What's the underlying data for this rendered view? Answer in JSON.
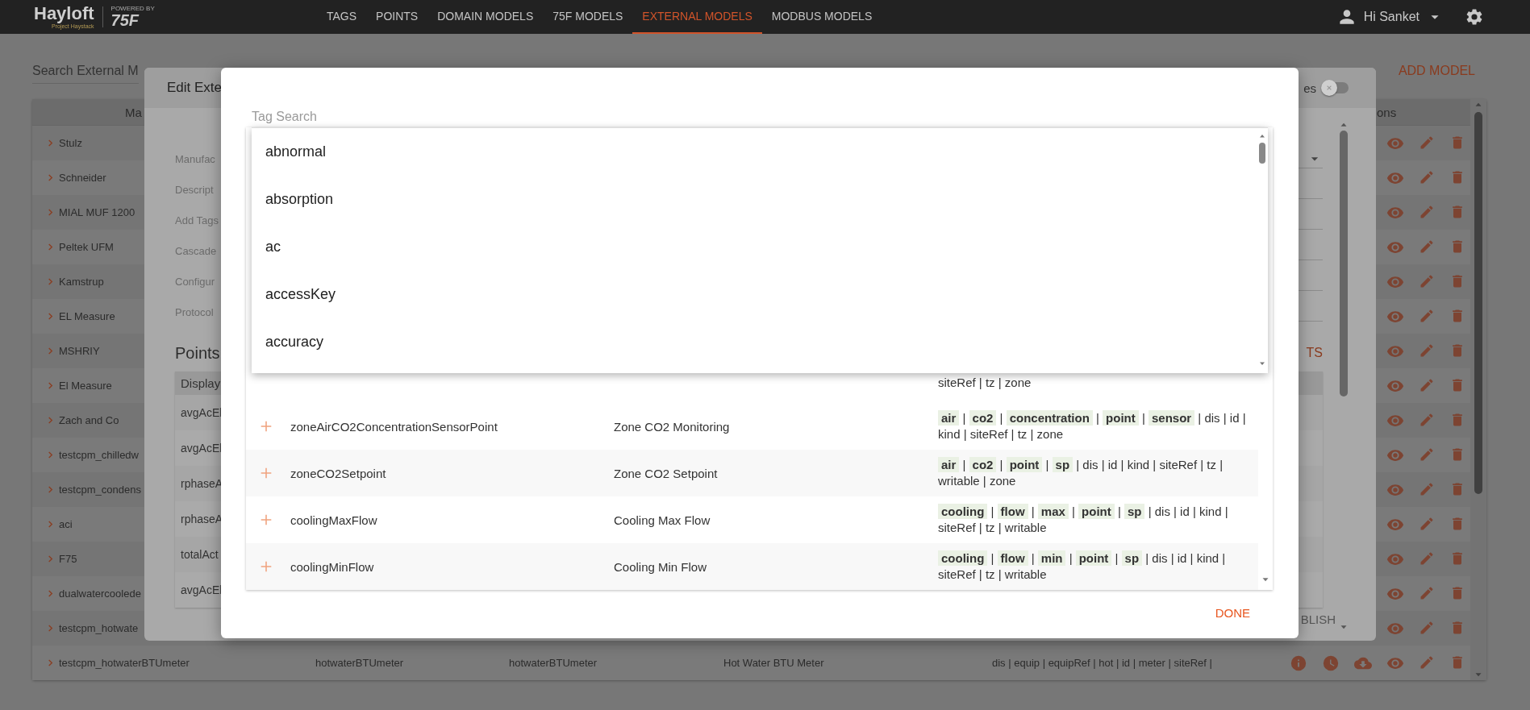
{
  "nav": {
    "logo": "Hayloft",
    "logo_subtitle": "Project Haystack",
    "powered_by": "POWERED BY",
    "brand": "75F",
    "items": [
      {
        "label": "TAGS",
        "selected": false
      },
      {
        "label": "POINTS",
        "selected": false
      },
      {
        "label": "DOMAIN MODELS",
        "selected": false
      },
      {
        "label": "75F MODELS",
        "selected": false
      },
      {
        "label": "EXTERNAL MODELS",
        "selected": true
      },
      {
        "label": "MODBUS MODELS",
        "selected": false
      }
    ],
    "user": "Hi Sanket"
  },
  "page": {
    "search_label": "Search External M",
    "add_button": "ADD MODEL",
    "table": {
      "columns": [
        "Ma",
        "ons"
      ],
      "rows": [
        {
          "kind": "name_only",
          "name": "Stulz"
        },
        {
          "kind": "name_only",
          "name": "Schneider"
        },
        {
          "kind": "name_only",
          "name": "MIAL MUF 1200"
        },
        {
          "kind": "name_only",
          "name": "Peltek UFM"
        },
        {
          "kind": "name_only",
          "name": "Kamstrup"
        },
        {
          "kind": "name_only",
          "name": "EL Measure"
        },
        {
          "kind": "name_only",
          "name": "MSHRIY"
        },
        {
          "kind": "name_only",
          "name": "El Measure"
        },
        {
          "kind": "name_only",
          "name": "Zach and Co"
        },
        {
          "kind": "name_only",
          "name": "testcpm_chilledw"
        },
        {
          "kind": "name_only",
          "name": "testcpm_condens"
        },
        {
          "kind": "name_only",
          "name": "aci"
        },
        {
          "kind": "name_only",
          "name": "F75"
        },
        {
          "kind": "name_only",
          "name": "dualwatercoolede"
        },
        {
          "kind": "name_only",
          "name": "testcpm_hotwate"
        },
        {
          "kind": "full",
          "name": "testcpm_hotwaterBTUmeter",
          "column_2": "hotwaterBTUmeter",
          "column_3": "hotwaterBTUmeter",
          "column_4": "Hot Water BTU Meter",
          "tags": "dis | equip | equipRef | hot | id | meter | siteRef |"
        }
      ]
    }
  },
  "edit_modal": {
    "title": "Edit Exte",
    "toggle_label": "es",
    "toggle_on": false,
    "labels": [
      "Manufac",
      "Descript",
      "Add Tags",
      "Cascade",
      "Configur",
      "Protocol"
    ],
    "points_title": "Points",
    "add_points": "TS",
    "points_header": "Display",
    "points_rows": [
      "avgAcEl",
      "avgAcEl",
      "rphaseA",
      "rphaseA",
      "totalAct",
      "avgAcEl"
    ],
    "publish": "BLISH"
  },
  "tag_modal": {
    "search_label": "Tag Search",
    "suggestions": [
      "abnormal",
      "absorption",
      "ac",
      "accessKey",
      "accuracy"
    ],
    "partial_row_tags": "siteRef | tz | zone",
    "rows": [
      {
        "name": "zoneAirCO2ConcentrationSensorPoint",
        "display": "Zone CO2 Monitoring",
        "tags": "**air** | **co2** | **concentration** | **point** | **sensor** | dis | id | kind | siteRef | tz | zone"
      },
      {
        "name": "zoneCO2Setpoint",
        "display": "Zone CO2 Setpoint",
        "tags": "**air** | **co2** | **point** | **sp** | dis | id | kind | siteRef | tz | writable | zone"
      },
      {
        "name": "coolingMaxFlow",
        "display": "Cooling Max Flow",
        "tags": "**cooling** | **flow** | **max** | **point** | **sp** | dis | id | kind | siteRef | tz | writable"
      },
      {
        "name": "coolingMinFlow",
        "display": "Cooling Min Flow",
        "tags": "**cooling** | **flow** | **min** | **point** | **sp** | dis | id | kind | siteRef | tz | writable"
      }
    ],
    "done": "DONE"
  }
}
